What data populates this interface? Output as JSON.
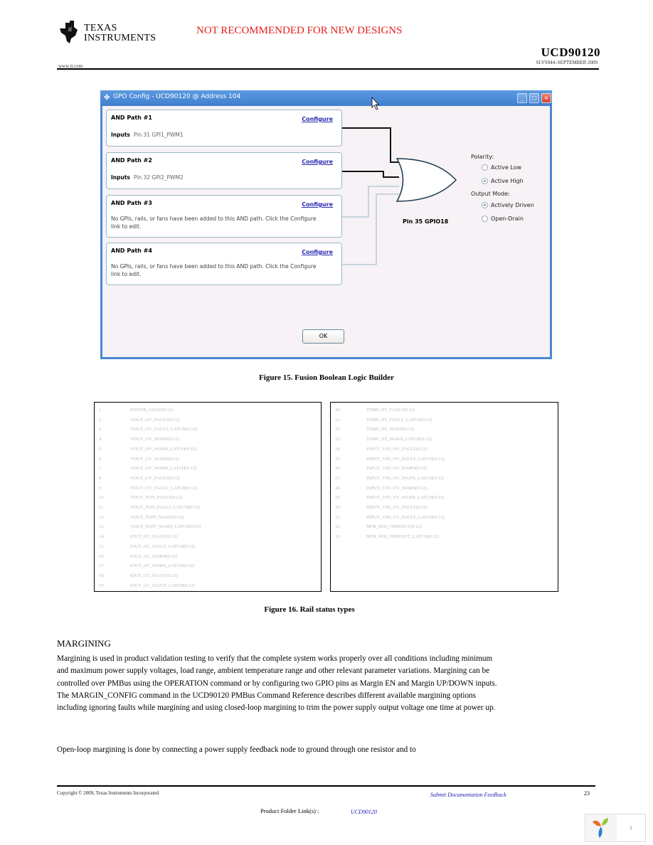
{
  "header": {
    "company_line1": "TEXAS",
    "company_line2": "INSTRUMENTS",
    "notice": "NOT RECOMMENDED FOR NEW DESIGNS",
    "doc_number": "UCD90120",
    "doc_date": "SLVS944–SEPTEMBER 2009",
    "website": "www.ti.com"
  },
  "dialog": {
    "title": "GPO Config - UCD90120 @ Address 104",
    "window_buttons": {
      "minimize": "_",
      "maximize": "□",
      "close": "×"
    },
    "paths": [
      {
        "title": "AND Path #1",
        "configure_label": "Configure",
        "inputs_label": "Inputs",
        "inputs_value": "Pin 31 GPI1_PWM1",
        "message": ""
      },
      {
        "title": "AND Path #2",
        "configure_label": "Configure",
        "inputs_label": "Inputs",
        "inputs_value": "Pin 32 GPI2_PWM2",
        "message": ""
      },
      {
        "title": "AND Path #3",
        "configure_label": "Configure",
        "inputs_label": "",
        "inputs_value": "",
        "message": "No GPIs, rails, or fans have been added to this AND path. Click the Configure link to edit."
      },
      {
        "title": "AND Path #4",
        "configure_label": "Configure",
        "inputs_label": "",
        "inputs_value": "",
        "message": "No GPIs, rails, or fans have been added to this AND path. Click the Configure link to edit."
      }
    ],
    "output_pin": "Pin 35 GPIO18",
    "polarity": {
      "label": "Polarity:",
      "options": [
        {
          "label": "Active Low",
          "selected": false
        },
        {
          "label": "Active High",
          "selected": true
        }
      ]
    },
    "output_mode": {
      "label": "Output Mode:",
      "options": [
        {
          "label": "Actively Driven",
          "selected": true
        },
        {
          "label": "Open-Drain",
          "selected": false
        }
      ]
    },
    "ok_label": "OK"
  },
  "figure15_caption": "Figure 15. Fusion Boolean Logic Builder",
  "rail_status": {
    "left": [
      {
        "n": "1.",
        "name": "POWER_GOOD(0:12)"
      },
      {
        "n": "2.",
        "name": "VOUT_OV_FAULT(0:12)"
      },
      {
        "n": "3.",
        "name": "VOUT_OV_FAULT_LATCH(0:12)"
      },
      {
        "n": "4.",
        "name": "VOUT_OV_WARN(0:12)"
      },
      {
        "n": "5.",
        "name": "VOUT_OV_WARN_LATCH(0:12)"
      },
      {
        "n": "6.",
        "name": "VOUT_UV_WARN(0:12)"
      },
      {
        "n": "7.",
        "name": "VOUT_UV_WARN_LATCH(0:12)"
      },
      {
        "n": "8.",
        "name": "VOUT_UV_FAULT(0:12)"
      },
      {
        "n": "9.",
        "name": "VOUT_UV_FAULT_LATCH(0:12)"
      },
      {
        "n": "10.",
        "name": "VOUT_TON_FAULT(0:12)"
      },
      {
        "n": "11.",
        "name": "VOUT_TON_FAULT_LATCH(0:12)"
      },
      {
        "n": "12.",
        "name": "VOUT_TOFF_WARN(0:12)"
      },
      {
        "n": "13.",
        "name": "VOUT_TOFF_WARN_LATCH(0:12)"
      },
      {
        "n": "14.",
        "name": "IOUT_OC_FAULT(0:12)"
      },
      {
        "n": "15.",
        "name": "IOUT_OC_FAULT_LATCH(0:12)"
      },
      {
        "n": "16.",
        "name": "IOUT_OC_WARN(0:12)"
      },
      {
        "n": "17.",
        "name": "IOUT_OC_WARN_LATCH(0:12)"
      },
      {
        "n": "18.",
        "name": "IOUT_UC_FAULT(0:12)"
      },
      {
        "n": "19.",
        "name": "IOUT_UC_FAULT_LATCH(0:12)"
      }
    ],
    "right": [
      {
        "n": "20.",
        "name": "TEMP_OT_FAULT(0:12)"
      },
      {
        "n": "21.",
        "name": "TEMP_OT_FAULT_LATCH(0:12)"
      },
      {
        "n": "22.",
        "name": "TEMP_OT_WARN(0:12)"
      },
      {
        "n": "23.",
        "name": "TEMP_OT_WARN_LATCH(0:12)"
      },
      {
        "n": "24.",
        "name": "INPUT_VIN_OV_FAULT(0:12)"
      },
      {
        "n": "25.",
        "name": "INPUT_VIN_OV_FAULT_LATCH(0:12)"
      },
      {
        "n": "26.",
        "name": "INPUT_VIN_OV_WARN(0:12)"
      },
      {
        "n": "27.",
        "name": "INPUT_VIN_OV_WARN_LATCH(0:12)"
      },
      {
        "n": "28.",
        "name": "INPUT_VIN_UV_WARN(0:12)"
      },
      {
        "n": "29.",
        "name": "INPUT_VIN_UV_WARN_LATCH(0:12)"
      },
      {
        "n": "30.",
        "name": "INPUT_VIN_UV_FAULT(0:12)"
      },
      {
        "n": "31.",
        "name": "INPUT_VIN_UV_FAULT_LATCH(0:12)"
      },
      {
        "n": "32.",
        "name": "MFR_SEQ_TIMEOUT(0:12)"
      },
      {
        "n": "33.",
        "name": "MFR_SEQ_TIMEOUT_LATCH(0:12)"
      }
    ]
  },
  "figure16_caption": "Figure 16. Rail status types",
  "margining": {
    "title": "MARGINING",
    "para1": "Margining is used in product validation testing to verify that the complete system works properly over all conditions including minimum and maximum power supply voltages, load range, ambient temperature range and other relevant parameter variations. Margining can be controlled over PMBus using the OPERATION command or by configuring two GPIO pins as Margin EN and Margin UP/DOWN inputs. The MARGIN_CONFIG command in the UCD90120 PMBus Command Reference describes different available margining options including ignoring faults while margining and using closed-loop margining to trim the power supply output voltage one time at power up.",
    "para2": "Open-loop margining is done by connecting a power supply feedback node to ground through one resistor and to"
  },
  "footer": {
    "copyright": "Copyright © 2009, Texas Instruments Incorporated",
    "feedback_link": "Submit Documentation Feedback",
    "page_number": "23",
    "product_folder_label": "Product Folder Link(s) :",
    "product_folder_link": "UCD90120"
  },
  "widget": {
    "next_label": "›"
  }
}
